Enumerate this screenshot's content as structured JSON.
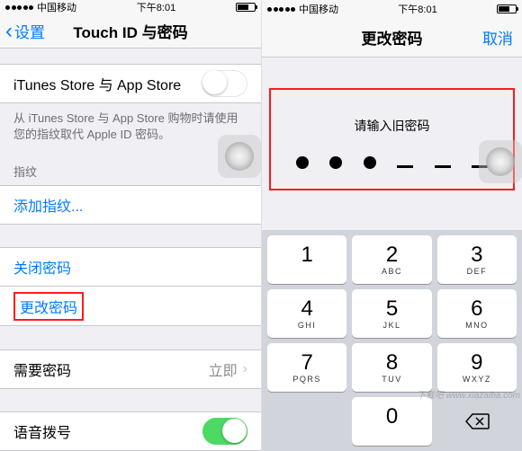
{
  "left": {
    "status": {
      "carrier": "中国移动",
      "time": "下午8:01"
    },
    "nav": {
      "back": "设置",
      "title": "Touch ID 与密码"
    },
    "rows": {
      "itunes": "iTunes Store 与 App Store",
      "note": "从 iTunes Store 与 App Store 购物时请使用您的指纹取代 Apple ID 密码。",
      "fingerprint_header": "指纹",
      "add_fingerprint": "添加指纹...",
      "turn_off_passcode": "关闭密码",
      "change_passcode": "更改密码",
      "require_passcode": "需要密码",
      "require_value": "立即",
      "voice_dial": "语音拨号"
    }
  },
  "right": {
    "status": {
      "carrier": "中国移动",
      "time": "下午8:01"
    },
    "nav": {
      "title": "更改密码",
      "cancel": "取消"
    },
    "prompt": "请输入旧密码",
    "filled_count": 3,
    "total_digits": 6,
    "keypad": [
      {
        "n": "1",
        "s": ""
      },
      {
        "n": "2",
        "s": "ABC"
      },
      {
        "n": "3",
        "s": "DEF"
      },
      {
        "n": "4",
        "s": "GHI"
      },
      {
        "n": "5",
        "s": "JKL"
      },
      {
        "n": "6",
        "s": "MNO"
      },
      {
        "n": "7",
        "s": "PQRS"
      },
      {
        "n": "8",
        "s": "TUV"
      },
      {
        "n": "9",
        "s": "WXYZ"
      },
      {
        "n": "",
        "s": ""
      },
      {
        "n": "0",
        "s": ""
      },
      {
        "n": "⌫",
        "s": ""
      }
    ]
  },
  "watermark": "下载吧 www.xiazaiba.com"
}
